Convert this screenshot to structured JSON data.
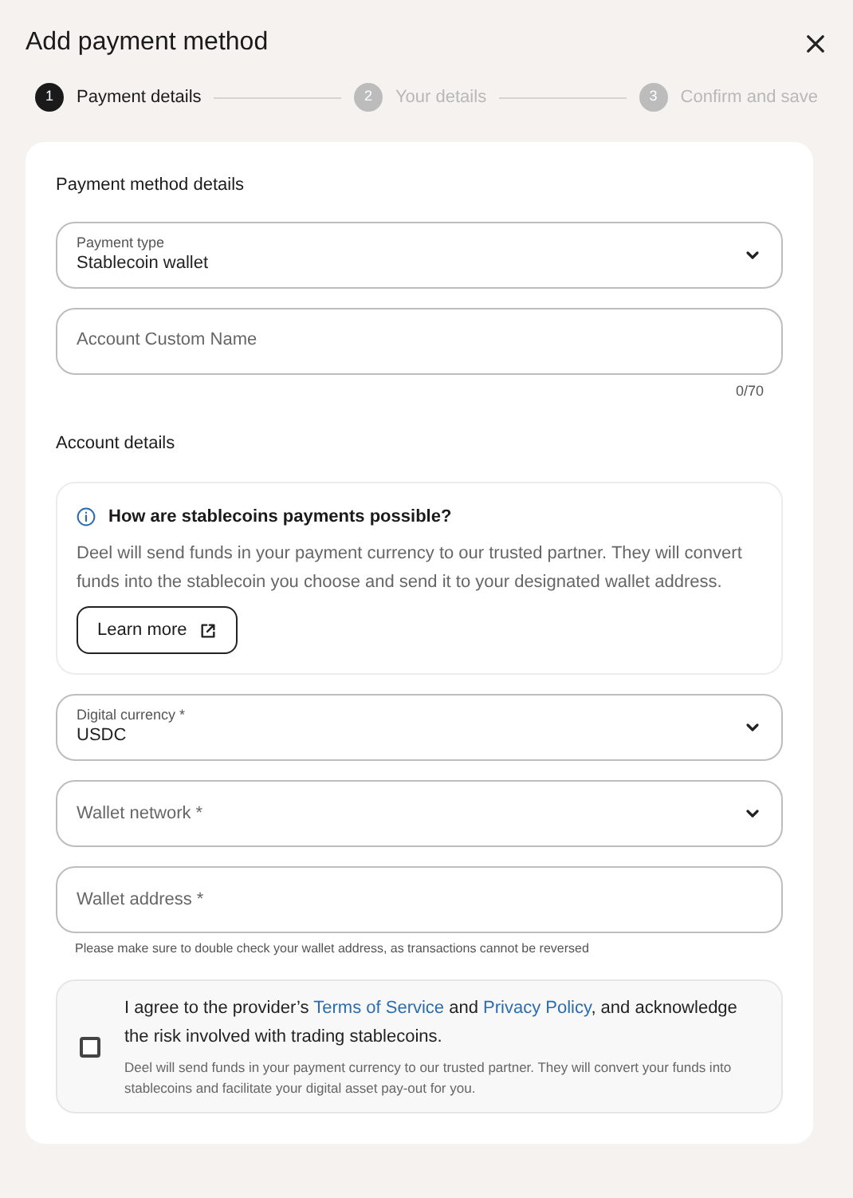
{
  "dialog": {
    "title": "Add payment method"
  },
  "steps": [
    {
      "number": "1",
      "label": "Payment details",
      "selected": true
    },
    {
      "number": "2",
      "label": "Your details",
      "selected": false
    },
    {
      "number": "3",
      "label": "Confirm and save",
      "selected": false
    }
  ],
  "payment_section": {
    "heading": "Payment method details",
    "fields": [
      {
        "kind": "select",
        "label": "Payment type",
        "value": "Stablecoin wallet"
      },
      {
        "kind": "input",
        "placeholder": "Account Custom Name",
        "counter": "0/70"
      }
    ]
  },
  "account_section": {
    "heading": "Account details",
    "info": {
      "title": "How are stablecoins payments possible?",
      "body": "Deel will send funds in your payment currency to our trusted partner. They will convert funds into the stablecoin you choose and send it to your designated wallet address.",
      "button": "Learn more"
    },
    "fields": [
      {
        "kind": "select",
        "label": "Digital currency *",
        "value": "USDC"
      },
      {
        "kind": "select",
        "placeholder": "Wallet network *"
      },
      {
        "kind": "input",
        "placeholder": "Wallet address *",
        "hint": "Please make sure to double check your wallet address, as transactions cannot be reversed"
      }
    ]
  },
  "consent": {
    "checked": false,
    "segments": [
      {
        "kind": "text",
        "text": "I agree to the provider’s "
      },
      {
        "kind": "link",
        "text": "Terms of Service"
      },
      {
        "kind": "text",
        "text": " and "
      },
      {
        "kind": "link",
        "text": "Privacy Policy"
      },
      {
        "kind": "text",
        "text": ", and acknowledge the risk involved with trading stablecoins."
      }
    ],
    "note": "Deel will send funds in your payment currency to our trusted partner. They will convert your funds into stablecoins and facilitate your digital asset pay-out for you."
  }
}
